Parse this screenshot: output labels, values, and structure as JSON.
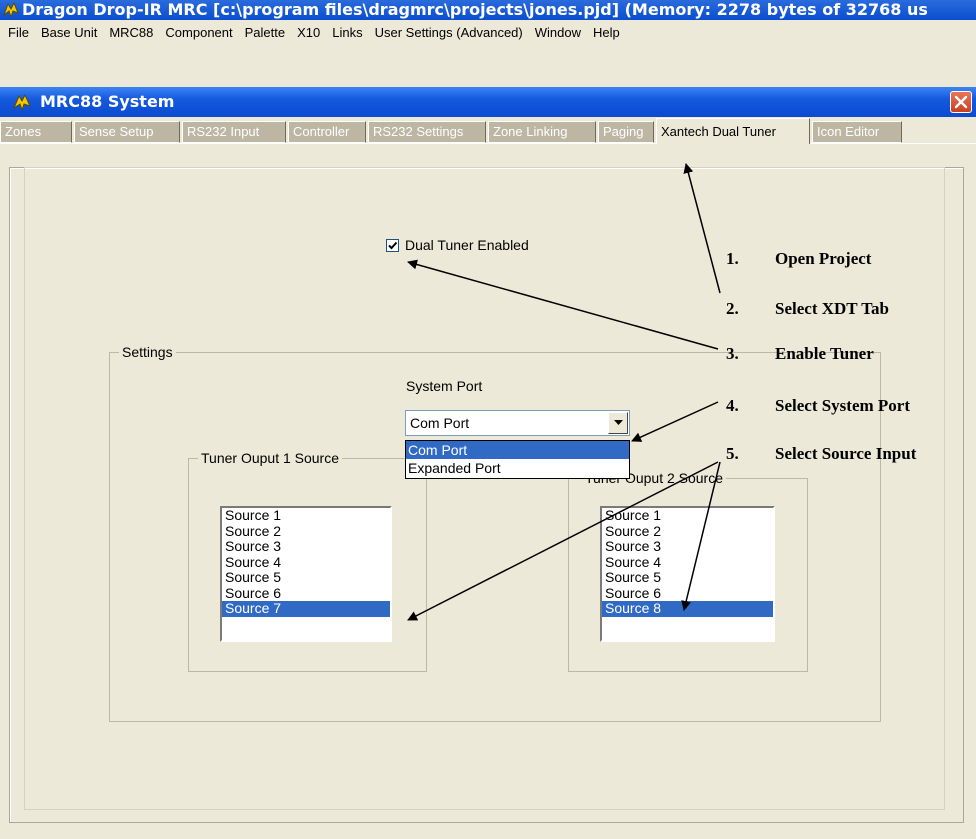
{
  "app": {
    "title": "Dragon Drop-IR MRC [c:\\program files\\dragmrc\\projects\\jones.pjd] (Memory: 2278 bytes of 32768 us"
  },
  "menubar": {
    "items": [
      "File",
      "Base Unit",
      "MRC88",
      "Component",
      "Palette",
      "X10",
      "Links",
      "User Settings (Advanced)",
      "Window",
      "Help"
    ]
  },
  "window": {
    "title": "MRC88 System",
    "close_icon": "close-x-icon"
  },
  "tabs": [
    {
      "label": "Zones",
      "active": false
    },
    {
      "label": "Sense Setup",
      "active": false
    },
    {
      "label": "RS232 Input",
      "active": false
    },
    {
      "label": "Controller",
      "active": false
    },
    {
      "label": "RS232 Settings",
      "active": false
    },
    {
      "label": "Zone Linking",
      "active": false
    },
    {
      "label": "Paging",
      "active": false
    },
    {
      "label": "Xantech Dual Tuner",
      "active": true
    },
    {
      "label": "Icon Editor",
      "active": false
    }
  ],
  "dual_tuner": {
    "label": "Dual Tuner Enabled",
    "checked": true
  },
  "settings": {
    "legend": "Settings",
    "system_port_label": "System Port",
    "system_port_value": "Com Port",
    "system_port_options": [
      "Com Port",
      "Expanded Port"
    ],
    "tuner1": {
      "legend": "Tuner Ouput 1 Source",
      "sources": [
        "Source 1",
        "Source 2",
        "Source 3",
        "Source 4",
        "Source 5",
        "Source 6",
        "Source 7"
      ],
      "selected": "Source 7"
    },
    "tuner2": {
      "legend": "Tuner Ouput 2 Source",
      "sources": [
        "Source 1",
        "Source 2",
        "Source 3",
        "Source 4",
        "Source 5",
        "Source 6",
        "Source 8"
      ],
      "selected": "Source 8"
    }
  },
  "steps": [
    {
      "num": "1.",
      "text": "Open Project"
    },
    {
      "num": "2.",
      "text": "Select XDT Tab"
    },
    {
      "num": "3.",
      "text": "Enable Tuner"
    },
    {
      "num": "4.",
      "text": "Select System Port"
    },
    {
      "num": "5.",
      "text": "Select Source Input"
    }
  ],
  "colors": {
    "titlebar": "#0a4ed0",
    "selection": "#316ac5",
    "background": "#ece9d8",
    "close_button": "#c8401e"
  }
}
